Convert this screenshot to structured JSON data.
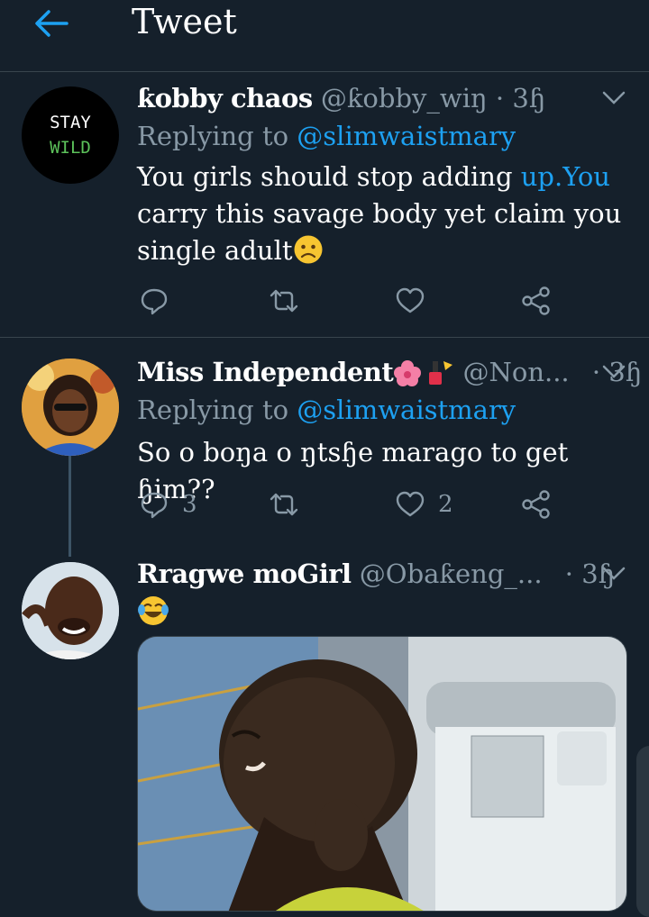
{
  "header": {
    "title": "Tweet",
    "back_icon": "arrow-left-icon"
  },
  "colors": {
    "background": "#15202b",
    "accent": "#1da1f2",
    "secondary_text": "#8899a6",
    "divider": "#38444d"
  },
  "tweets": [
    {
      "display_name": "ƙobby chaos",
      "handle": "@ƙobby_wiŋ",
      "time": "· 3ɧ",
      "replying_prefix": "Replying to",
      "replying_to": "@slimwaistmary",
      "body_part1": "You girls should stop adding ",
      "body_link": "up.You",
      "body_part2": "carry this savage body yet claim you single adult",
      "body_emoji": "worried-face-emoji",
      "avatar_text_top": "STAY",
      "avatar_text_bottom": "WILD",
      "reply_count": "",
      "like_count": ""
    },
    {
      "display_name": "Miss Independent",
      "display_name_emoji": "flower-and-nail-polish-emoji",
      "handle": "@Non...",
      "time": "· 3ɧ",
      "replying_prefix": "Replying to",
      "replying_to": "@slimwaistmary",
      "body": "So o boŋa o ŋtsɧe marago to get ɧim??",
      "reply_count": "3",
      "like_count": "2"
    },
    {
      "display_name": "Rragwe moGirl",
      "handle": "@Obaƙeng_...",
      "time": "· 3ɧ",
      "body_emoji": "face-with-tears-of-joy-emoji",
      "media": "photo-of-man-touching-neck"
    }
  ]
}
